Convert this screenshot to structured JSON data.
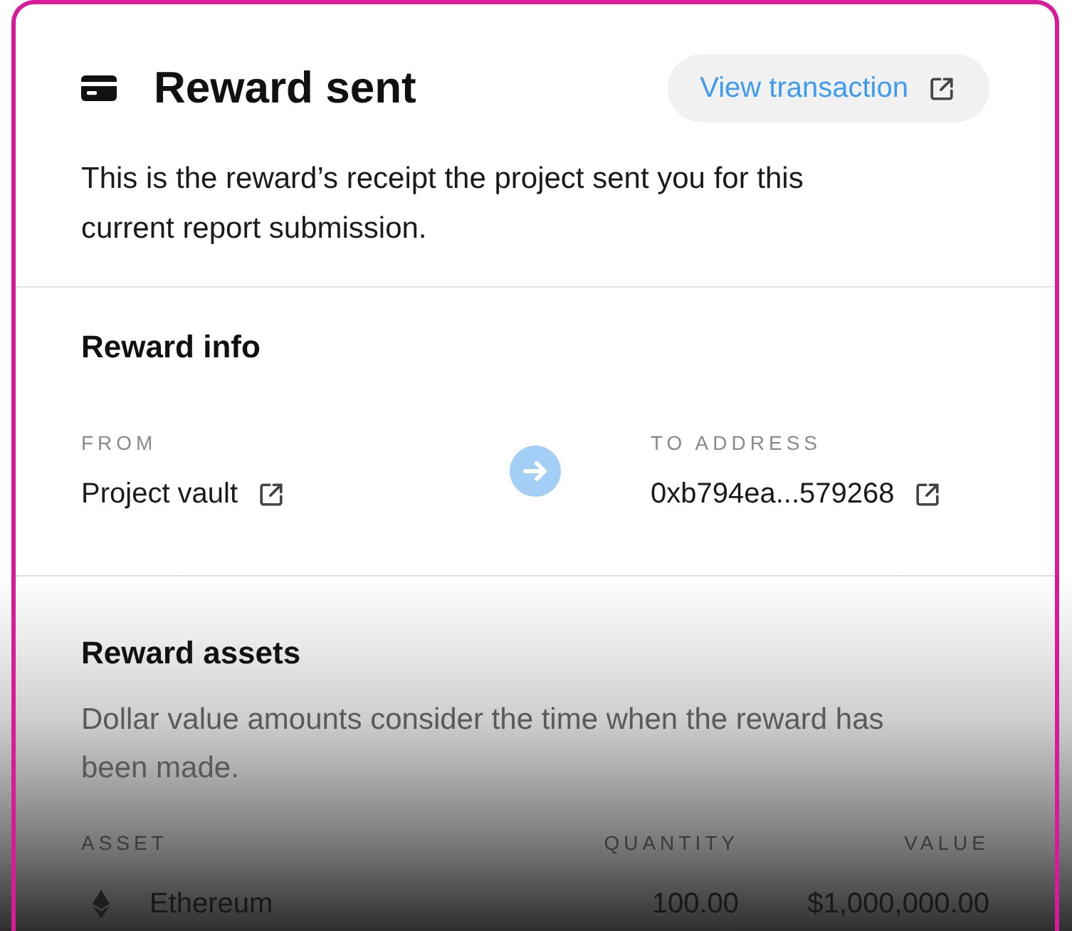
{
  "header": {
    "title": "Reward sent",
    "action": {
      "label": "View transaction"
    },
    "description": "This is the reward’s receipt the project sent you for this current report submission."
  },
  "reward_info": {
    "title": "Reward info",
    "from": {
      "label": "FROM",
      "value": "Project vault"
    },
    "to": {
      "label": "TO ADDRESS",
      "value": "0xb794ea...579268"
    }
  },
  "reward_assets": {
    "title": "Reward assets",
    "description": "Dollar value amounts consider the time when the reward has been made.",
    "table": {
      "columns": [
        "ASSET",
        "QUANTITY",
        "VALUE"
      ],
      "rows": [
        {
          "asset": "Ethereum",
          "quantity": "100.00",
          "value": "$1,000,000.00"
        }
      ]
    }
  }
}
